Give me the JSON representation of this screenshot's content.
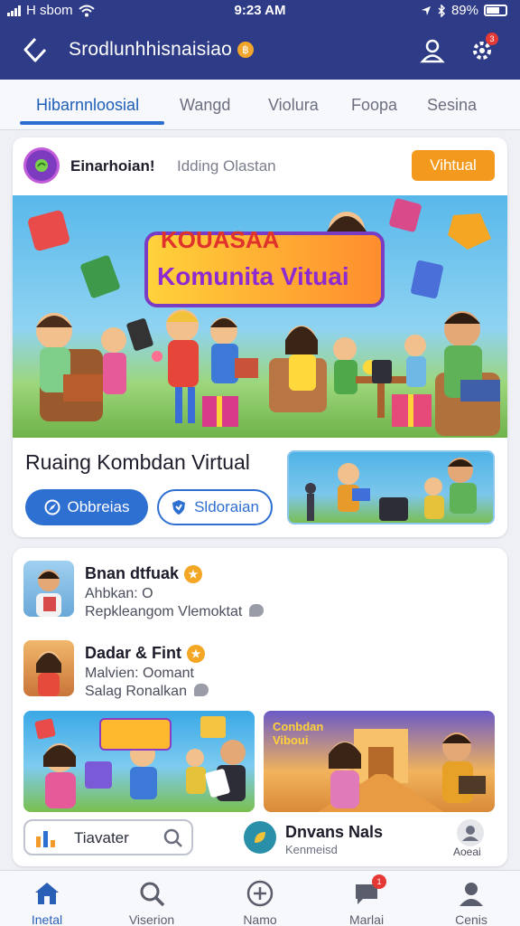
{
  "status_bar": {
    "carrier": "H sbom",
    "time": "9:23 AM",
    "battery": "89%"
  },
  "header": {
    "title": "Srodlunhhisnaisiao",
    "coin_glyph": "฿",
    "notification_count": "3",
    "background_color": "#2e3b86"
  },
  "tabs": [
    {
      "label": "Hibarnnloosial",
      "active": true
    },
    {
      "label": "Wangd"
    },
    {
      "label": "Violura"
    },
    {
      "label": "Foopa"
    },
    {
      "label": "Sesina"
    }
  ],
  "feature_card": {
    "author": "Einarhoian!",
    "subtitle": "Idding Olastan",
    "badge_label": "Vihtual",
    "banner_top_text": "KOUASAA",
    "banner_main_text": "Komunita Vituai",
    "title": "Ruaing Kombdan Virtual",
    "primary_button": "Obbreias",
    "secondary_button": "Sldoraian",
    "accent_color": "#f39a1e",
    "primary_color": "#2e6fd2"
  },
  "list": {
    "items": [
      {
        "title": "Bnan dtfuak",
        "line1": "Ahbkan: O",
        "line2": "Repkleangom Vlemoktat"
      },
      {
        "title": "Dadar & Fint",
        "line1": "Malvien: Oomant",
        "line2": "Salag Ronalkan"
      }
    ],
    "tile_a_sign": "",
    "tile_b_sign": "Conbdan Viboui",
    "search_label": "Tiavater",
    "profile_name": "Dnvans Nals",
    "profile_sub": "Kenmeisd",
    "mini_label": "Aoeai"
  },
  "bottom_nav": [
    {
      "label": "Inetal",
      "icon": "home-icon",
      "active": true
    },
    {
      "label": "Viserion",
      "icon": "search-icon"
    },
    {
      "label": "Namo",
      "icon": "add-icon"
    },
    {
      "label": "Marlai",
      "icon": "chat-icon",
      "badge": "1"
    },
    {
      "label": "Cenis",
      "icon": "profile-icon"
    }
  ]
}
